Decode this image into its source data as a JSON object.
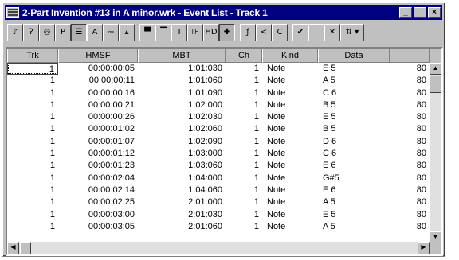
{
  "window": {
    "title": "2-Part Invention #13 in A minor.wrk - Event List - Track 1",
    "controls": {
      "minimize": "_",
      "maximize": "□",
      "close": "×"
    }
  },
  "toolbar": {
    "buttons": [
      {
        "name": "note-filter",
        "glyph": "♪"
      },
      {
        "name": "rest-filter",
        "glyph": "ʔ"
      },
      {
        "name": "key-aftertouch-filter",
        "glyph": "◎"
      },
      {
        "name": "patch-filter",
        "glyph": "P"
      },
      {
        "name": "controller-filter",
        "glyph": "☰"
      },
      {
        "name": "channel-aftertouch-filter",
        "glyph": "A"
      },
      {
        "name": "wheel-filter",
        "glyph": "⎓"
      },
      {
        "name": "rpn-filter",
        "glyph": "▴"
      },
      {
        "name": "sysx-filter",
        "glyph": "▀"
      },
      {
        "name": "text-filter",
        "glyph": "▔"
      },
      {
        "name": "lyric-filter",
        "glyph": "T"
      },
      {
        "name": "mci-filter",
        "glyph": "⊪"
      },
      {
        "name": "wave-filter",
        "glyph": "HD"
      },
      {
        "name": "expression-filter",
        "glyph": "✚"
      },
      {
        "name": "dynamics-filter",
        "glyph": "ƒ"
      },
      {
        "name": "hairpin-filter",
        "glyph": "<"
      },
      {
        "name": "chord-filter",
        "glyph": "C"
      },
      {
        "name": "checkmark",
        "glyph": "✔"
      },
      {
        "name": "blank",
        "glyph": ""
      },
      {
        "name": "delete-event",
        "glyph": "✕"
      },
      {
        "name": "insert-event",
        "glyph": "⇅ ▾"
      }
    ]
  },
  "columns": [
    "Trk",
    "HMSF",
    "MBT",
    "Ch",
    "Kind",
    "Data",
    ""
  ],
  "rows": [
    {
      "trk": "1",
      "hmsf": "00:00:00:05",
      "mbt": "1:01:030",
      "ch": "1",
      "kind": "Note",
      "data": "E 5",
      "vel": "80"
    },
    {
      "trk": "1",
      "hmsf": "00:00:00:11",
      "mbt": "1:01:060",
      "ch": "1",
      "kind": "Note",
      "data": "A 5",
      "vel": "80"
    },
    {
      "trk": "1",
      "hmsf": "00:00:00:16",
      "mbt": "1:01:090",
      "ch": "1",
      "kind": "Note",
      "data": "C 6",
      "vel": "80"
    },
    {
      "trk": "1",
      "hmsf": "00:00:00:21",
      "mbt": "1:02:000",
      "ch": "1",
      "kind": "Note",
      "data": "B 5",
      "vel": "80"
    },
    {
      "trk": "1",
      "hmsf": "00:00:00:26",
      "mbt": "1:02:030",
      "ch": "1",
      "kind": "Note",
      "data": "E 5",
      "vel": "80"
    },
    {
      "trk": "1",
      "hmsf": "00:00:01:02",
      "mbt": "1:02:060",
      "ch": "1",
      "kind": "Note",
      "data": "B 5",
      "vel": "80"
    },
    {
      "trk": "1",
      "hmsf": "00:00:01:07",
      "mbt": "1:02:090",
      "ch": "1",
      "kind": "Note",
      "data": "D 6",
      "vel": "80"
    },
    {
      "trk": "1",
      "hmsf": "00:00:01:12",
      "mbt": "1:03:000",
      "ch": "1",
      "kind": "Note",
      "data": "C 6",
      "vel": "80"
    },
    {
      "trk": "1",
      "hmsf": "00:00:01:23",
      "mbt": "1:03:060",
      "ch": "1",
      "kind": "Note",
      "data": "E 6",
      "vel": "80"
    },
    {
      "trk": "1",
      "hmsf": "00:00:02:04",
      "mbt": "1:04:000",
      "ch": "1",
      "kind": "Note",
      "data": "G#5",
      "vel": "80"
    },
    {
      "trk": "1",
      "hmsf": "00:00:02:14",
      "mbt": "1:04:060",
      "ch": "1",
      "kind": "Note",
      "data": "E 6",
      "vel": "80"
    },
    {
      "trk": "1",
      "hmsf": "00:00:02:25",
      "mbt": "2:01:000",
      "ch": "1",
      "kind": "Note",
      "data": "A 5",
      "vel": "80"
    },
    {
      "trk": "1",
      "hmsf": "00:00:03:00",
      "mbt": "2:01:030",
      "ch": "1",
      "kind": "Note",
      "data": "E 5",
      "vel": "80"
    },
    {
      "trk": "1",
      "hmsf": "00:00:03:05",
      "mbt": "2:01:060",
      "ch": "1",
      "kind": "Note",
      "data": "A 5",
      "vel": "80"
    }
  ],
  "scrollbars": {
    "up": "▲",
    "down": "▼",
    "left": "◀",
    "right": "▶"
  }
}
